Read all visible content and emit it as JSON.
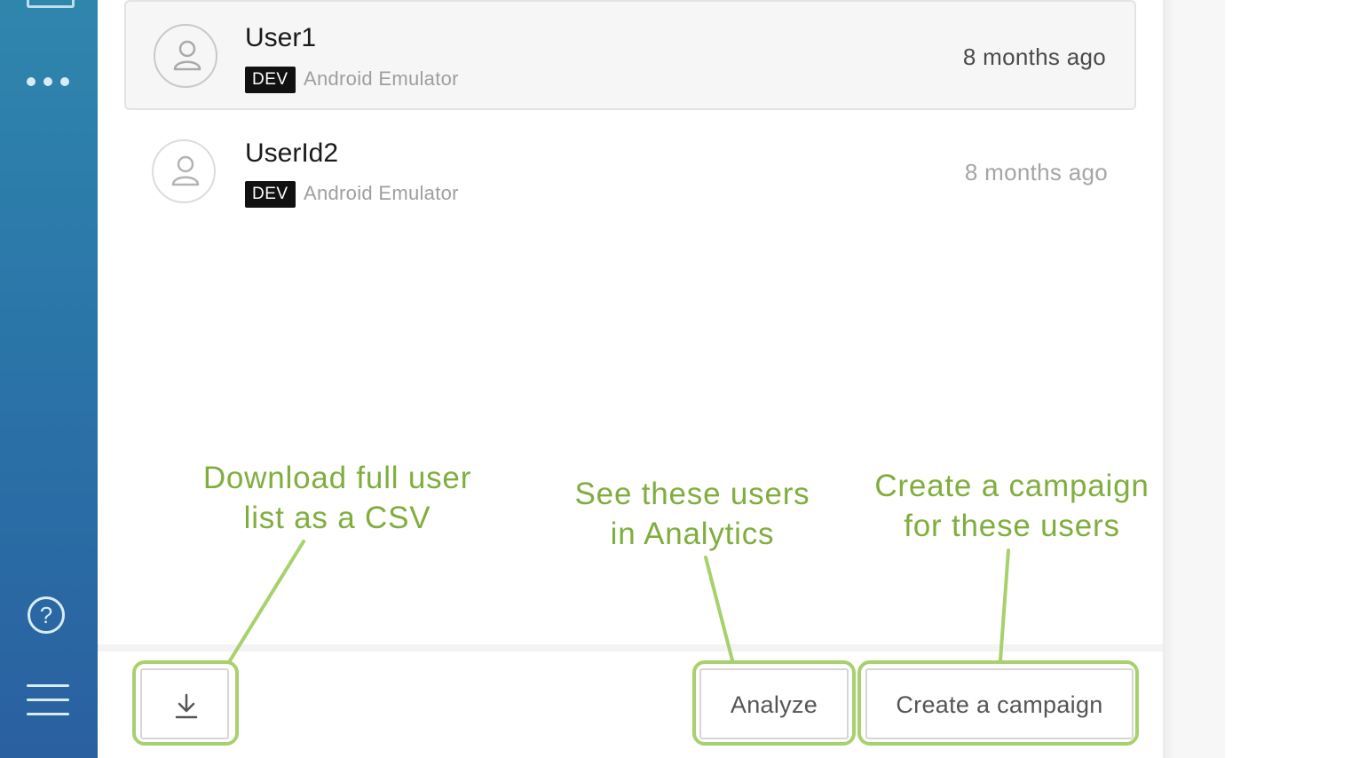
{
  "sidebar": {
    "more_icon": "ellipsis-icon",
    "help_glyph": "?",
    "help_icon": "help-circle-icon",
    "menu_icon": "hamburger-menu-icon"
  },
  "users": [
    {
      "name": "User1",
      "badge": "DEV",
      "device": "Android Emulator",
      "last_seen": "8 months ago",
      "selected": true
    },
    {
      "name": "UserId2",
      "badge": "DEV",
      "device": "Android Emulator",
      "last_seen": "8 months ago",
      "selected": false
    }
  ],
  "footer": {
    "download_icon": "download-icon",
    "analyze_label": "Analyze",
    "campaign_label": "Create a campaign"
  },
  "callouts": {
    "download": [
      "Download full user",
      "list as a CSV"
    ],
    "analyze": [
      "See these users",
      "in Analytics"
    ],
    "campaign": [
      "Create a campaign",
      "for these users"
    ]
  },
  "colors": {
    "sidebar": "#2a73a8",
    "highlight": "#a6d16b",
    "callout_text": "#7fae3e",
    "badge_bg": "#111111"
  }
}
